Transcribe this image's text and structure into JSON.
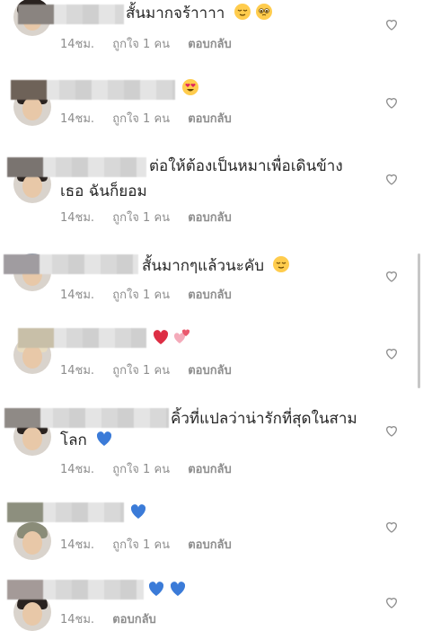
{
  "comments": [
    {
      "text": "สั้นมากจร้าาาา",
      "time": "14ชม.",
      "likes": "ถูกใจ 1 คน",
      "reply": "ตอบกลับ",
      "emojis": [
        "relieved-face",
        "pleading-face"
      ]
    },
    {
      "text": "",
      "time": "14ชม.",
      "likes": "ถูกใจ 1 คน",
      "reply": "ตอบกลับ",
      "emojis": [
        "heart-eyes-face"
      ]
    },
    {
      "text_line1": "ต่อให้ต้องเป็นหมาเพื่อเดินข้าง",
      "text_line2": "เธอ ฉันก็ยอม",
      "time": "14ชม.",
      "likes": "ถูกใจ 1 คน",
      "reply": "ตอบกลับ"
    },
    {
      "text": "สั้นมากๆแล้วนะคับ",
      "time": "14ชม.",
      "likes": "ถูกใจ 1 คน",
      "reply": "ตอบกลับ",
      "emojis": [
        "relieved-face"
      ]
    },
    {
      "text": "",
      "time": "14ชม.",
      "likes": "ถูกใจ 1 คน",
      "reply": "ตอบกลับ",
      "emojis": [
        "red-heart",
        "two-hearts"
      ]
    },
    {
      "text_line1": "คิ้วที่แปลว่าน่ารักที่สุดในสาม",
      "text_line2": "โลก",
      "time": "14ชม.",
      "likes": "ถูกใจ 1 คน",
      "reply": "ตอบกลับ",
      "emojis": [
        "blue-heart"
      ]
    },
    {
      "text": "",
      "time": "14ชม.",
      "likes": "ถูกใจ 1 คน",
      "reply": "ตอบกลับ",
      "emojis": [
        "blue-heart"
      ]
    },
    {
      "text": "",
      "time": "14ชม.",
      "reply": "ตอบกลับ",
      "emojis": [
        "blue-heart",
        "blue-heart"
      ]
    }
  ],
  "colors": {
    "text": "#262626",
    "meta": "#8e8e8e",
    "red_heart": "#e0245e",
    "blue_heart": "#3b7bd8"
  }
}
